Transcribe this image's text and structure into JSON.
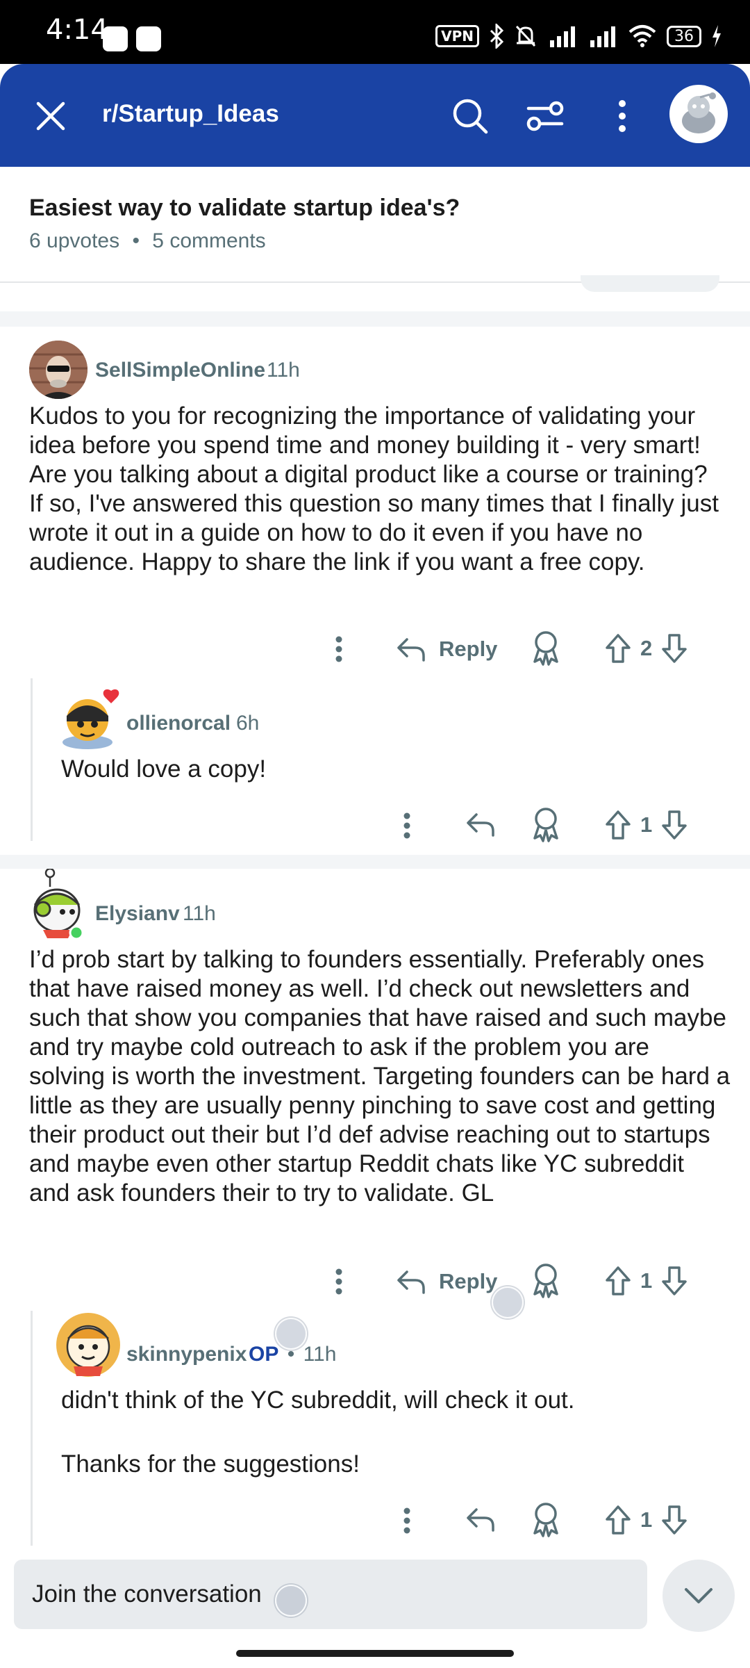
{
  "status_bar": {
    "time": "4:14",
    "vpn": "VPN",
    "battery": "36"
  },
  "header": {
    "subreddit": "r/Startup_Ideas"
  },
  "post": {
    "title": "Easiest way to validate startup idea's?",
    "upvotes": "6 upvotes",
    "separator": "•",
    "comments": "5 comments"
  },
  "comments": [
    {
      "user": "SellSimpleOnline",
      "time": "11h",
      "body": "Kudos to you for recognizing the importance of validating your idea before you spend time and money building it - very smart! Are you talking about a digital product like a course or training? If so, I've answered this question so many times that I finally just wrote it out in a guide on how to do it even if you have no audience. Happy to share the link if you want a free copy.",
      "reply_label": "Reply",
      "votes": "2"
    },
    {
      "user": "ollienorcal",
      "time": "6h",
      "body": "Would love a copy!",
      "votes": "1"
    },
    {
      "user": "Elysianv",
      "time": "11h",
      "body": "I’d prob start by talking to founders essentially. Preferably ones that have raised money as well. I’d check out newsletters and such that show you companies that have raised and such maybe and try maybe cold outreach to ask if the problem you are solving is worth the investment. Targeting founders can be hard a little as they are usually penny pinching to save cost and getting their product out their but I’d def advise reaching out to startups and maybe even other startup Reddit chats like YC subreddit and ask founders their to try to validate. GL",
      "reply_label": "Reply",
      "votes": "1"
    },
    {
      "user": "skinnypenix",
      "op": "OP",
      "dot": "•",
      "time": "11h",
      "body1": "didn't think of the YC subreddit, will check it out.",
      "body2": "Thanks for the suggestions!",
      "votes": "1"
    }
  ],
  "composer": {
    "placeholder": "Join the conversation"
  },
  "colors": {
    "header": "#1a43a4",
    "meta_text": "#576f76",
    "body_text": "#1c1c1c",
    "op_badge": "#1a43a4"
  },
  "icons": [
    "close-icon",
    "search-icon",
    "filter-icon",
    "more-vert-icon",
    "reply-icon",
    "award-icon",
    "upvote-icon",
    "downvote-icon",
    "chevron-down-icon"
  ]
}
